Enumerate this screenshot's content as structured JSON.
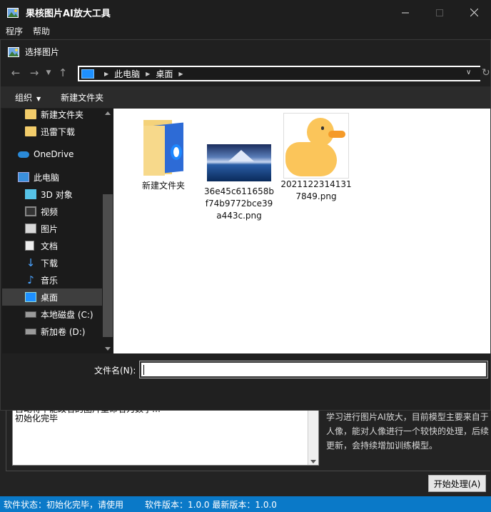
{
  "app": {
    "title": "果核图片AI放大工具",
    "menu": [
      "程序",
      "帮助"
    ],
    "log_lines": [
      "自动将不能改名的图片重命名为数字…",
      "初始化完毕"
    ],
    "info": "学习进行图片AI放大，目前模型主要来自于人像，能对人像进行一个较快的处理，后续更新，会持续增加训练模型。",
    "start_button": "开始处理(A)",
    "status": {
      "state": "软件状态：初始化完毕，请使用",
      "version": "软件版本：1.0.0 最新版本：1.0.0"
    }
  },
  "dialog": {
    "title": "选择图片",
    "address": {
      "root": "此电脑",
      "current": "桌面"
    },
    "commands": {
      "organize": "组织",
      "new_folder": "新建文件夹"
    },
    "tree": [
      {
        "label": "新建文件夹",
        "icon": "folder-icon"
      },
      {
        "label": "迅雷下载",
        "icon": "folder-icon"
      },
      {
        "label": "OneDrive",
        "icon": "onedrive-icon"
      },
      {
        "label": "此电脑",
        "icon": "this-pc-icon"
      },
      {
        "label": "3D 对象",
        "icon": "3d-objects-icon"
      },
      {
        "label": "视频",
        "icon": "videos-icon"
      },
      {
        "label": "图片",
        "icon": "pictures-icon"
      },
      {
        "label": "文档",
        "icon": "documents-icon"
      },
      {
        "label": "下载",
        "icon": "downloads-icon"
      },
      {
        "label": "音乐",
        "icon": "music-icon"
      },
      {
        "label": "桌面",
        "icon": "desktop-icon",
        "selected": true
      },
      {
        "label": "本地磁盘 (C:)",
        "icon": "disk-icon"
      },
      {
        "label": "新加卷 (D:)",
        "icon": "disk-icon"
      }
    ],
    "files": [
      {
        "name": "新建文件夹",
        "type": "folder"
      },
      {
        "name": "36e45c611658bf74b9772bce39a443c.png",
        "type": "image"
      },
      {
        "name": "20211223141317849.png",
        "type": "image"
      }
    ],
    "filename_label": "文件名(N):",
    "filename_value": ""
  }
}
